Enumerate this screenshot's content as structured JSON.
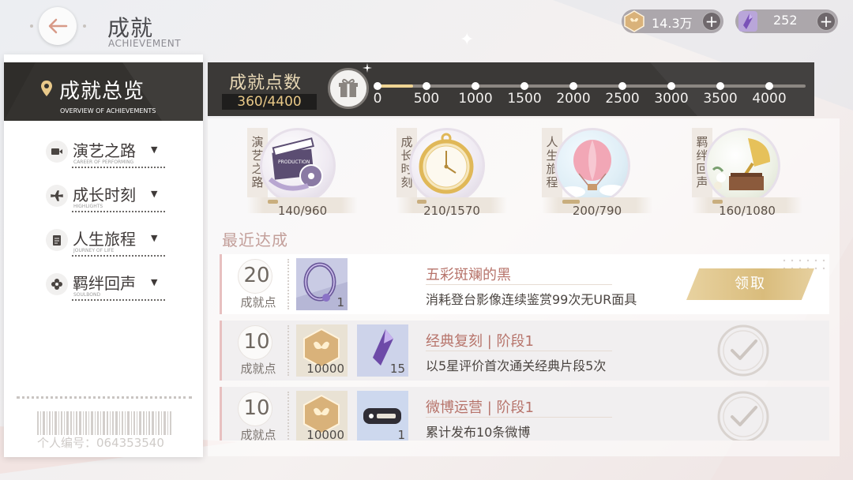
{
  "header": {
    "title": "成就",
    "subtitle": "ACHIEVEMENT"
  },
  "currency": [
    {
      "icon": "gold-coin-icon",
      "value": "14.3万"
    },
    {
      "icon": "purple-crystal-icon",
      "value": "252"
    }
  ],
  "sidebar": {
    "title": "成就总览",
    "subtitle": "OVERVIEW OF ACHIEVEMENTS",
    "items": [
      {
        "label": "演艺之路",
        "sub": "CAREER OF PERFORMING",
        "icon": "video-camera-icon"
      },
      {
        "label": "成长时刻",
        "sub": "HIGHLIGHTS",
        "icon": "airplane-icon"
      },
      {
        "label": "人生旅程",
        "sub": "JOURNEY OF LIFE",
        "icon": "document-icon"
      },
      {
        "label": "羁绊回声",
        "sub": "SOULBOND",
        "icon": "flower-icon"
      }
    ],
    "personal_id": "个人编号：064353540"
  },
  "points": {
    "title": "成就点数",
    "value": "360/4400",
    "current": 360,
    "max": 4400,
    "ticks": [
      "0",
      "500",
      "1000",
      "1500",
      "2000",
      "2500",
      "3000",
      "3500",
      "4000"
    ]
  },
  "categories": [
    {
      "label": "演艺之路",
      "progress": "140/960",
      "current": 140,
      "max": 960,
      "icon": "film-clapperboard-icon"
    },
    {
      "label": "成长时刻",
      "progress": "210/1570",
      "current": 210,
      "max": 1570,
      "icon": "pocket-watch-icon"
    },
    {
      "label": "人生旅程",
      "progress": "200/790",
      "current": 200,
      "max": 790,
      "icon": "hot-air-balloon-icon"
    },
    {
      "label": "羁绊回声",
      "progress": "160/1080",
      "current": 160,
      "max": 1080,
      "icon": "gramophone-icon"
    }
  ],
  "recent": {
    "title": "最近达成",
    "rows": [
      {
        "points": "20",
        "points_label": "成就点",
        "rewards": [
          {
            "icon": "purple-ring-icon",
            "count": "1"
          }
        ],
        "title": "五彩斑斓的黑",
        "desc": "消耗登台影像连续鉴赏99次无UR面具",
        "action": "领取",
        "state": "claimable"
      },
      {
        "points": "10",
        "points_label": "成就点",
        "rewards": [
          {
            "icon": "gold-coin-icon",
            "count": "10000"
          },
          {
            "icon": "purple-crystal-icon",
            "count": "15"
          }
        ],
        "title": "经典复刻 | 阶段1",
        "desc": "以5星评价首次通关经典片段5次",
        "state": "claimed"
      },
      {
        "points": "10",
        "points_label": "成就点",
        "rewards": [
          {
            "icon": "gold-coin-icon",
            "count": "10000"
          },
          {
            "icon": "chat-sticker-icon",
            "count": "1"
          }
        ],
        "title": "微博运营 | 阶段1",
        "desc": "累计发布10条微博",
        "state": "claimed"
      }
    ]
  }
}
